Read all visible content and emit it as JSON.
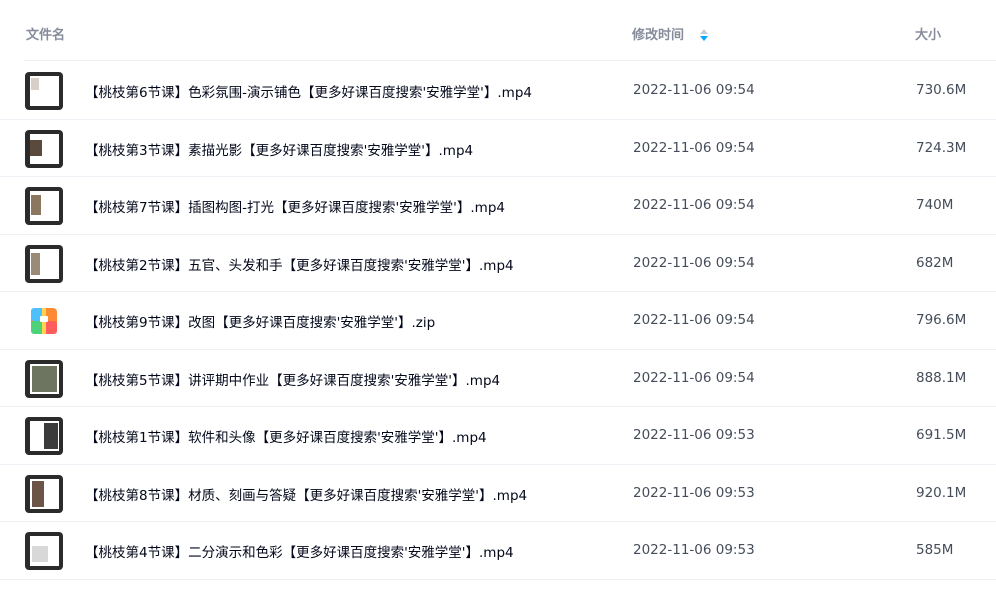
{
  "header": {
    "name_label": "文件名",
    "time_label": "修改时间",
    "size_label": "大小"
  },
  "files": [
    {
      "name": "【桃枝第6节课】色彩氛围-演示铺色【更多好课百度搜索'安雅学堂'】.mp4",
      "time": "2022-11-06 09:54",
      "size": "730.6M",
      "type": "video-icon"
    },
    {
      "name": "【桃枝第3节课】素描光影【更多好课百度搜索'安雅学堂'】.mp4",
      "time": "2022-11-06 09:54",
      "size": "724.3M",
      "type": "video-icon"
    },
    {
      "name": "【桃枝第7节课】插图构图-打光【更多好课百度搜索'安雅学堂'】.mp4",
      "time": "2022-11-06 09:54",
      "size": "740M",
      "type": "video-icon"
    },
    {
      "name": "【桃枝第2节课】五官、头发和手【更多好课百度搜索'安雅学堂'】.mp4",
      "time": "2022-11-06 09:54",
      "size": "682M",
      "type": "video-icon"
    },
    {
      "name": "【桃枝第9节课】改图【更多好课百度搜索'安雅学堂'】.zip",
      "time": "2022-11-06 09:54",
      "size": "796.6M",
      "type": "zip-icon"
    },
    {
      "name": "【桃枝第5节课】讲评期中作业【更多好课百度搜索'安雅学堂'】.mp4",
      "time": "2022-11-06 09:54",
      "size": "888.1M",
      "type": "video-icon"
    },
    {
      "name": "【桃枝第1节课】软件和头像【更多好课百度搜索'安雅学堂'】.mp4",
      "time": "2022-11-06 09:53",
      "size": "691.5M",
      "type": "video-icon"
    },
    {
      "name": "【桃枝第8节课】材质、刻画与答疑【更多好课百度搜索'安雅学堂'】.mp4",
      "time": "2022-11-06 09:53",
      "size": "920.1M",
      "type": "video-icon"
    },
    {
      "name": "【桃枝第4节课】二分演示和色彩【更多好课百度搜索'安雅学堂'】.mp4",
      "time": "2022-11-06 09:53",
      "size": "585M",
      "type": "video-icon"
    }
  ],
  "colors": {
    "header_text": "#878c9c",
    "sort_active": "#06a7ff",
    "row_divider": "#eef0f5"
  }
}
